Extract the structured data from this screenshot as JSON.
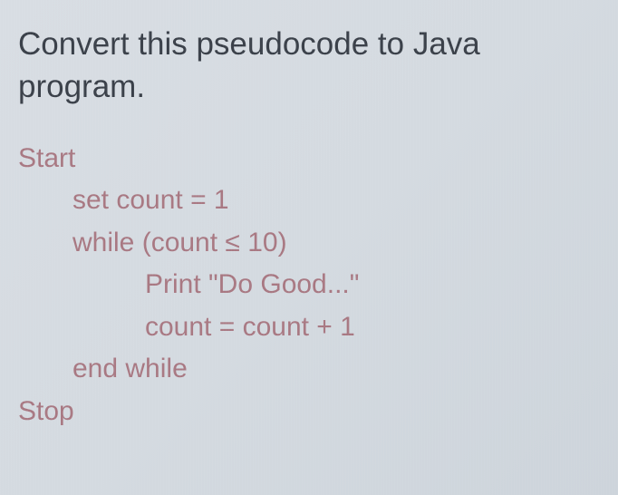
{
  "heading": {
    "line1": "Convert this pseudocode to Java",
    "line2": "program."
  },
  "pseudocode": {
    "start": "Start",
    "set_count": "set count = 1",
    "while_open": "while (count ≤ 10)",
    "print_line": "Print \"Do Good...\"",
    "increment": "count = count + 1",
    "end_while": "end while",
    "stop": "Stop"
  }
}
